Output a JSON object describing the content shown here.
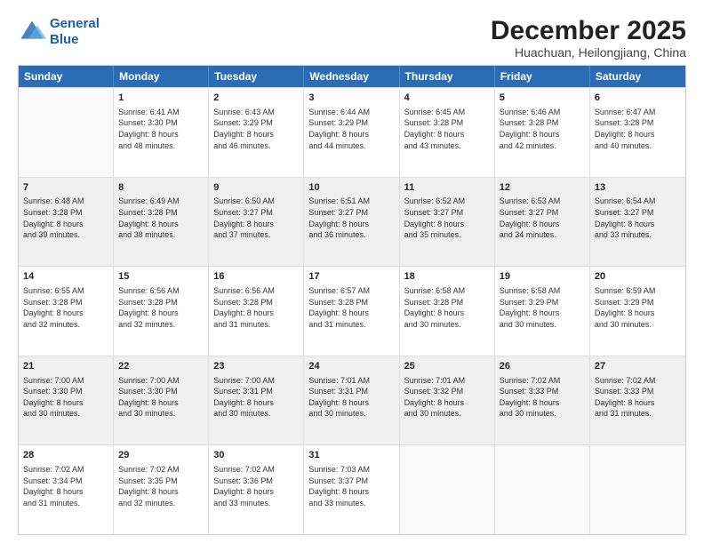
{
  "logo": {
    "line1": "General",
    "line2": "Blue"
  },
  "title": "December 2025",
  "subtitle": "Huachuan, Heilongjiang, China",
  "header_days": [
    "Sunday",
    "Monday",
    "Tuesday",
    "Wednesday",
    "Thursday",
    "Friday",
    "Saturday"
  ],
  "weeks": [
    [
      {
        "day": "",
        "info": ""
      },
      {
        "day": "1",
        "info": "Sunrise: 6:41 AM\nSunset: 3:30 PM\nDaylight: 8 hours\nand 48 minutes."
      },
      {
        "day": "2",
        "info": "Sunrise: 6:43 AM\nSunset: 3:29 PM\nDaylight: 8 hours\nand 46 minutes."
      },
      {
        "day": "3",
        "info": "Sunrise: 6:44 AM\nSunset: 3:29 PM\nDaylight: 8 hours\nand 44 minutes."
      },
      {
        "day": "4",
        "info": "Sunrise: 6:45 AM\nSunset: 3:28 PM\nDaylight: 8 hours\nand 43 minutes."
      },
      {
        "day": "5",
        "info": "Sunrise: 6:46 AM\nSunset: 3:28 PM\nDaylight: 8 hours\nand 42 minutes."
      },
      {
        "day": "6",
        "info": "Sunrise: 6:47 AM\nSunset: 3:28 PM\nDaylight: 8 hours\nand 40 minutes."
      }
    ],
    [
      {
        "day": "7",
        "info": "Sunrise: 6:48 AM\nSunset: 3:28 PM\nDaylight: 8 hours\nand 39 minutes."
      },
      {
        "day": "8",
        "info": "Sunrise: 6:49 AM\nSunset: 3:28 PM\nDaylight: 8 hours\nand 38 minutes."
      },
      {
        "day": "9",
        "info": "Sunrise: 6:50 AM\nSunset: 3:27 PM\nDaylight: 8 hours\nand 37 minutes."
      },
      {
        "day": "10",
        "info": "Sunrise: 6:51 AM\nSunset: 3:27 PM\nDaylight: 8 hours\nand 36 minutes."
      },
      {
        "day": "11",
        "info": "Sunrise: 6:52 AM\nSunset: 3:27 PM\nDaylight: 8 hours\nand 35 minutes."
      },
      {
        "day": "12",
        "info": "Sunrise: 6:53 AM\nSunset: 3:27 PM\nDaylight: 8 hours\nand 34 minutes."
      },
      {
        "day": "13",
        "info": "Sunrise: 6:54 AM\nSunset: 3:27 PM\nDaylight: 8 hours\nand 33 minutes."
      }
    ],
    [
      {
        "day": "14",
        "info": "Sunrise: 6:55 AM\nSunset: 3:28 PM\nDaylight: 8 hours\nand 32 minutes."
      },
      {
        "day": "15",
        "info": "Sunrise: 6:56 AM\nSunset: 3:28 PM\nDaylight: 8 hours\nand 32 minutes."
      },
      {
        "day": "16",
        "info": "Sunrise: 6:56 AM\nSunset: 3:28 PM\nDaylight: 8 hours\nand 31 minutes."
      },
      {
        "day": "17",
        "info": "Sunrise: 6:57 AM\nSunset: 3:28 PM\nDaylight: 8 hours\nand 31 minutes."
      },
      {
        "day": "18",
        "info": "Sunrise: 6:58 AM\nSunset: 3:28 PM\nDaylight: 8 hours\nand 30 minutes."
      },
      {
        "day": "19",
        "info": "Sunrise: 6:58 AM\nSunset: 3:29 PM\nDaylight: 8 hours\nand 30 minutes."
      },
      {
        "day": "20",
        "info": "Sunrise: 6:59 AM\nSunset: 3:29 PM\nDaylight: 8 hours\nand 30 minutes."
      }
    ],
    [
      {
        "day": "21",
        "info": "Sunrise: 7:00 AM\nSunset: 3:30 PM\nDaylight: 8 hours\nand 30 minutes."
      },
      {
        "day": "22",
        "info": "Sunrise: 7:00 AM\nSunset: 3:30 PM\nDaylight: 8 hours\nand 30 minutes."
      },
      {
        "day": "23",
        "info": "Sunrise: 7:00 AM\nSunset: 3:31 PM\nDaylight: 8 hours\nand 30 minutes."
      },
      {
        "day": "24",
        "info": "Sunrise: 7:01 AM\nSunset: 3:31 PM\nDaylight: 8 hours\nand 30 minutes."
      },
      {
        "day": "25",
        "info": "Sunrise: 7:01 AM\nSunset: 3:32 PM\nDaylight: 8 hours\nand 30 minutes."
      },
      {
        "day": "26",
        "info": "Sunrise: 7:02 AM\nSunset: 3:33 PM\nDaylight: 8 hours\nand 30 minutes."
      },
      {
        "day": "27",
        "info": "Sunrise: 7:02 AM\nSunset: 3:33 PM\nDaylight: 8 hours\nand 31 minutes."
      }
    ],
    [
      {
        "day": "28",
        "info": "Sunrise: 7:02 AM\nSunset: 3:34 PM\nDaylight: 8 hours\nand 31 minutes."
      },
      {
        "day": "29",
        "info": "Sunrise: 7:02 AM\nSunset: 3:35 PM\nDaylight: 8 hours\nand 32 minutes."
      },
      {
        "day": "30",
        "info": "Sunrise: 7:02 AM\nSunset: 3:36 PM\nDaylight: 8 hours\nand 33 minutes."
      },
      {
        "day": "31",
        "info": "Sunrise: 7:03 AM\nSunset: 3:37 PM\nDaylight: 8 hours\nand 33 minutes."
      },
      {
        "day": "",
        "info": ""
      },
      {
        "day": "",
        "info": ""
      },
      {
        "day": "",
        "info": ""
      }
    ]
  ]
}
